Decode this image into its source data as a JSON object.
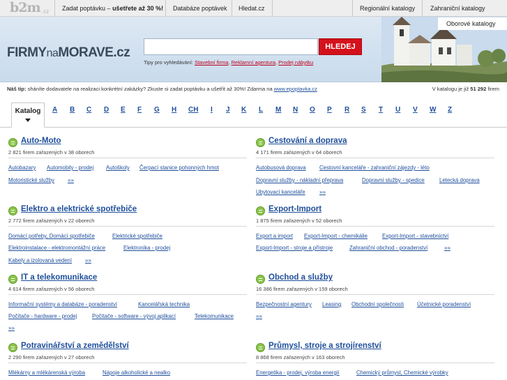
{
  "topbar": {
    "logo_text": "b2m",
    "logo_cz": ".cz",
    "link1_pre": "Zadat poptávku – ",
    "link1_bold": "ušetřete až 30 %!",
    "link2": "Databáze poptávek",
    "link3": "Hledat.cz",
    "link4": "Regionální katalogy",
    "link5": "Zahraniční katalogy",
    "dropdown": "Oborové katalogy"
  },
  "header": {
    "brand_1": "FIRMY",
    "brand_2": "na",
    "brand_3": "MORAVE.cz",
    "search_value": "",
    "search_button": "HLEDEJ",
    "tips_label": "Tipy pro vyhledávání: ",
    "tip1": "Stavební firma",
    "tip2": "Reklamní agentura",
    "tip3": "Prodej nábytku",
    "tip_sep": ", "
  },
  "tipline": {
    "bold": "Náš tip:",
    "text": " sháníte dodavatele na realizaci konkrétní zakázky? Zkuste si zadat poptávku a ušetřit až 30%! Zdarma na ",
    "link": "www.epoptavka.cz",
    "count_pre": "V katalogu je již ",
    "count_bold": "51 292",
    "count_post": " firem"
  },
  "alphabet": {
    "tab": "Katalog",
    "letters": [
      "A",
      "B",
      "C",
      "D",
      "E",
      "F",
      "G",
      "H",
      "CH",
      "I",
      "J",
      "K",
      "L",
      "M",
      "N",
      "O",
      "P",
      "R",
      "S",
      "T",
      "U",
      "V",
      "W",
      "Z"
    ]
  },
  "categories": [
    {
      "title": "Auto-Moto",
      "sub": "2 821 firem zařazených v 38 oborech",
      "links": [
        "Autobazary",
        "Automobily - prodej",
        "Autoškoly",
        "Čerpací stanice pohonných hmot",
        "Motoristické služby"
      ],
      "more": "»»"
    },
    {
      "title": "Cestování a doprava",
      "sub": "4 171 firem zařazených v 64 oborech",
      "links": [
        "Autobusová doprava",
        "Cestovní kanceláře - zahraniční zájezdy - léto",
        "Dopravní služby - nákladní přeprava",
        "Dopravní služby - spedice",
        "Letecká doprava",
        "Ubytovací kanceláře"
      ],
      "more": "»»"
    },
    {
      "title": "Elektro a elektrické spotřebiče",
      "sub": "2 772 firem zařazených v 22 oborech",
      "links": [
        "Domácí potřeby, Domácí spotřebiče",
        "Elektrické spotřebiče",
        "Elektroinstalace - elektromontážní práce",
        "Elektronika - prodej",
        "Kabely a izolovaná vedení"
      ],
      "more": "»»"
    },
    {
      "title": "Export-Import",
      "sub": "1 875 firem zařazených v 52 oborech",
      "links": [
        "Export a import",
        "Export-Import - chemikálie",
        "Export-Import - stavebnictví",
        "Export-Import - stroje a přístroje",
        "Zahraniční obchod - poradenství"
      ],
      "more": "»»"
    },
    {
      "title": "IT a telekomunikace",
      "sub": "4 614 firem zařazených v 56 oborech",
      "links": [
        "Informační systémy a databáze - poradenství",
        "Kancelářská technika",
        "Počítače - hardware - prodej",
        "Počítače - software - vývoj aplikací",
        "Telekomunikace"
      ],
      "more": "»»"
    },
    {
      "title": "Obchod a služby",
      "sub": "16 386 firem zařazených v 159 oborech",
      "links": [
        "Bezpečnostní agentury",
        "Leasing",
        "Obchodní společnosti",
        "Účetnické poradenství"
      ],
      "more": "»»"
    },
    {
      "title": "Potravinářství a zemědělství",
      "sub": "2 290 firem zařazených v 27 oborech",
      "links": [
        "Mlékárny a mlékárenská výroba",
        "Nápoje alkoholické a nealko"
      ],
      "more": "»»"
    },
    {
      "title": "Průmysl, stroje a strojírenství",
      "sub": "8 868 firem zařazených v 163 oborech",
      "links": [
        "Energetika - prodej, výroba energií",
        "Chemický průmysl, Chemické výrobky"
      ],
      "more": "»»"
    }
  ]
}
